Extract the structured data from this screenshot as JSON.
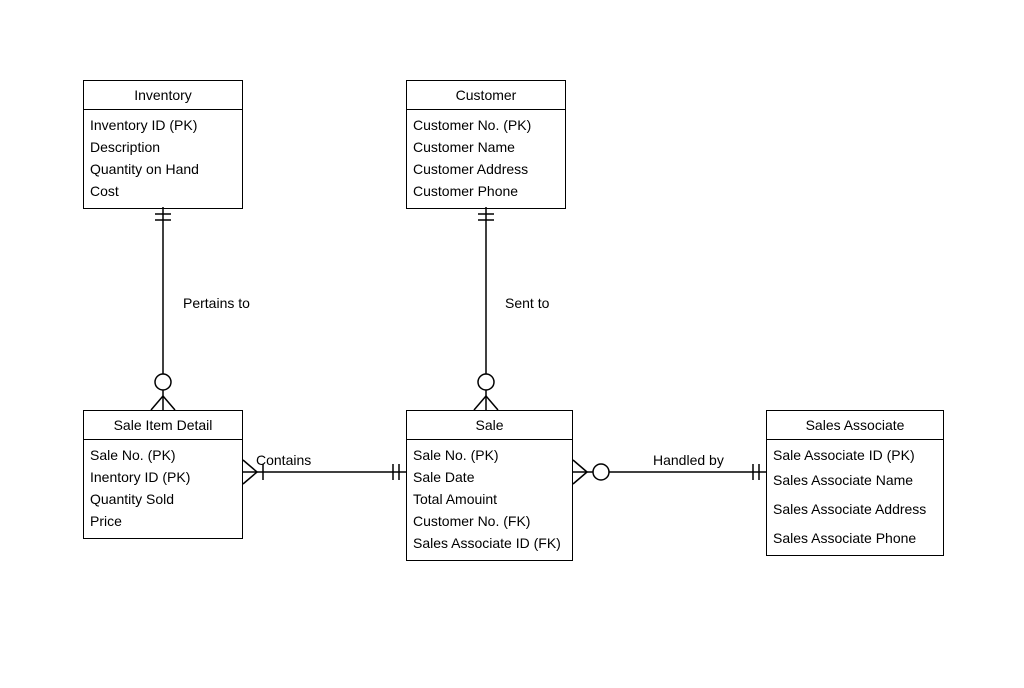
{
  "entities": {
    "inventory": {
      "title": "Inventory",
      "attrs": [
        "Inventory ID (PK)",
        "Description",
        "Quantity on Hand",
        "Cost"
      ]
    },
    "customer": {
      "title": "Customer",
      "attrs": [
        "Customer No. (PK)",
        "Customer Name",
        "Customer Address",
        "Customer Phone"
      ]
    },
    "sale_item_detail": {
      "title": "Sale Item Detail",
      "attrs": [
        "Sale No. (PK)",
        "Inentory ID (PK)",
        "Quantity Sold",
        "Price"
      ]
    },
    "sale": {
      "title": "Sale",
      "attrs": [
        "Sale No. (PK)",
        "Sale Date",
        "Total Amouint",
        "Customer No. (FK)",
        "Sales Associate ID (FK)"
      ]
    },
    "sales_associate": {
      "title": "Sales Associate",
      "attrs": [
        "Sale Associate ID (PK)",
        "Sales Associate Name",
        "Sales Associate Address",
        "Sales Associate Phone"
      ]
    }
  },
  "relationships": {
    "pertains_to": "Pertains to",
    "sent_to": "Sent to",
    "contains": "Contains",
    "handled_by": "Handled by"
  }
}
